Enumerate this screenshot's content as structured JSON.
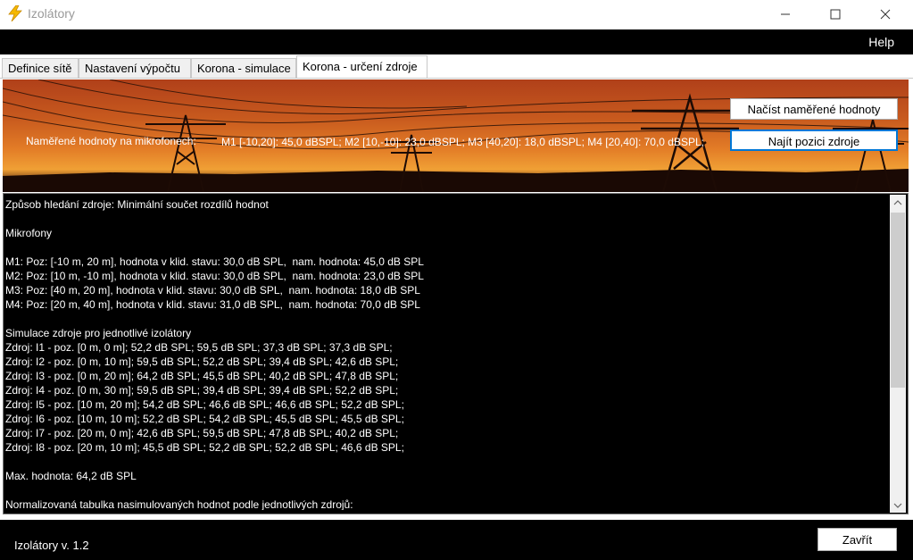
{
  "window": {
    "title": "Izolátory",
    "icon": "lightning-icon",
    "controls": [
      "minimize-icon",
      "maximize-icon",
      "close-icon"
    ]
  },
  "menu": {
    "help_label": "Help"
  },
  "tabs": [
    {
      "label": "Definice sítě",
      "active": false
    },
    {
      "label": "Nastavení výpočtu",
      "active": false
    },
    {
      "label": "Korona - simulace",
      "active": false
    },
    {
      "label": "Korona - určení zdroje",
      "active": true
    }
  ],
  "banner": {
    "measured_label": "Naměřené hodnoty na mikrofonech:",
    "measured_values": "M1 [-10,20]: 45,0 dBSPL; M2 [10,-10]: 23,0 dBSPL; M3 [40,20]: 18,0 dBSPL; M4 [20,40]: 70,0 dBSPL;",
    "load_button": "Načíst naměřené hodnoty",
    "find_button": "Najít pozici zdroje"
  },
  "output": {
    "lines": [
      "Způsob hledání zdroje: Minimální součet rozdílů hodnot",
      "",
      "Mikrofony",
      "",
      "M1: Poz: [-10 m, 20 m], hodnota v klid. stavu: 30,0 dB SPL,  nam. hodnota: 45,0 dB SPL",
      "M2: Poz: [10 m, -10 m], hodnota v klid. stavu: 30,0 dB SPL,  nam. hodnota: 23,0 dB SPL",
      "M3: Poz: [40 m, 20 m], hodnota v klid. stavu: 30,0 dB SPL,  nam. hodnota: 18,0 dB SPL",
      "M4: Poz: [20 m, 40 m], hodnota v klid. stavu: 31,0 dB SPL,  nam. hodnota: 70,0 dB SPL",
      "",
      "Simulace zdroje pro jednotlivé izolátory",
      "Zdroj: I1 - poz. [0 m, 0 m]; 52,2 dB SPL; 59,5 dB SPL; 37,3 dB SPL; 37,3 dB SPL;",
      "Zdroj: I2 - poz. [0 m, 10 m]; 59,5 dB SPL; 52,2 dB SPL; 39,4 dB SPL; 42,6 dB SPL;",
      "Zdroj: I3 - poz. [0 m, 20 m]; 64,2 dB SPL; 45,5 dB SPL; 40,2 dB SPL; 47,8 dB SPL;",
      "Zdroj: I4 - poz. [0 m, 30 m]; 59,5 dB SPL; 39,4 dB SPL; 39,4 dB SPL; 52,2 dB SPL;",
      "Zdroj: I5 - poz. [10 m, 20 m]; 54,2 dB SPL; 46,6 dB SPL; 46,6 dB SPL; 52,2 dB SPL;",
      "Zdroj: I6 - poz. [10 m, 10 m]; 52,2 dB SPL; 54,2 dB SPL; 45,5 dB SPL; 45,5 dB SPL;",
      "Zdroj: I7 - poz. [20 m, 0 m]; 42,6 dB SPL; 59,5 dB SPL; 47,8 dB SPL; 40,2 dB SPL;",
      "Zdroj: I8 - poz. [20 m, 10 m]; 45,5 dB SPL; 52,2 dB SPL; 52,2 dB SPL; 46,6 dB SPL;",
      "",
      "Max. hodnota: 64,2 dB SPL",
      "",
      "Normalizovaná tabulka nasimulovaných hodnot podle jednotlivých zdrojů:"
    ]
  },
  "footer": {
    "version": "Izolátory v. 1.2",
    "close_button": "Zavřít"
  }
}
